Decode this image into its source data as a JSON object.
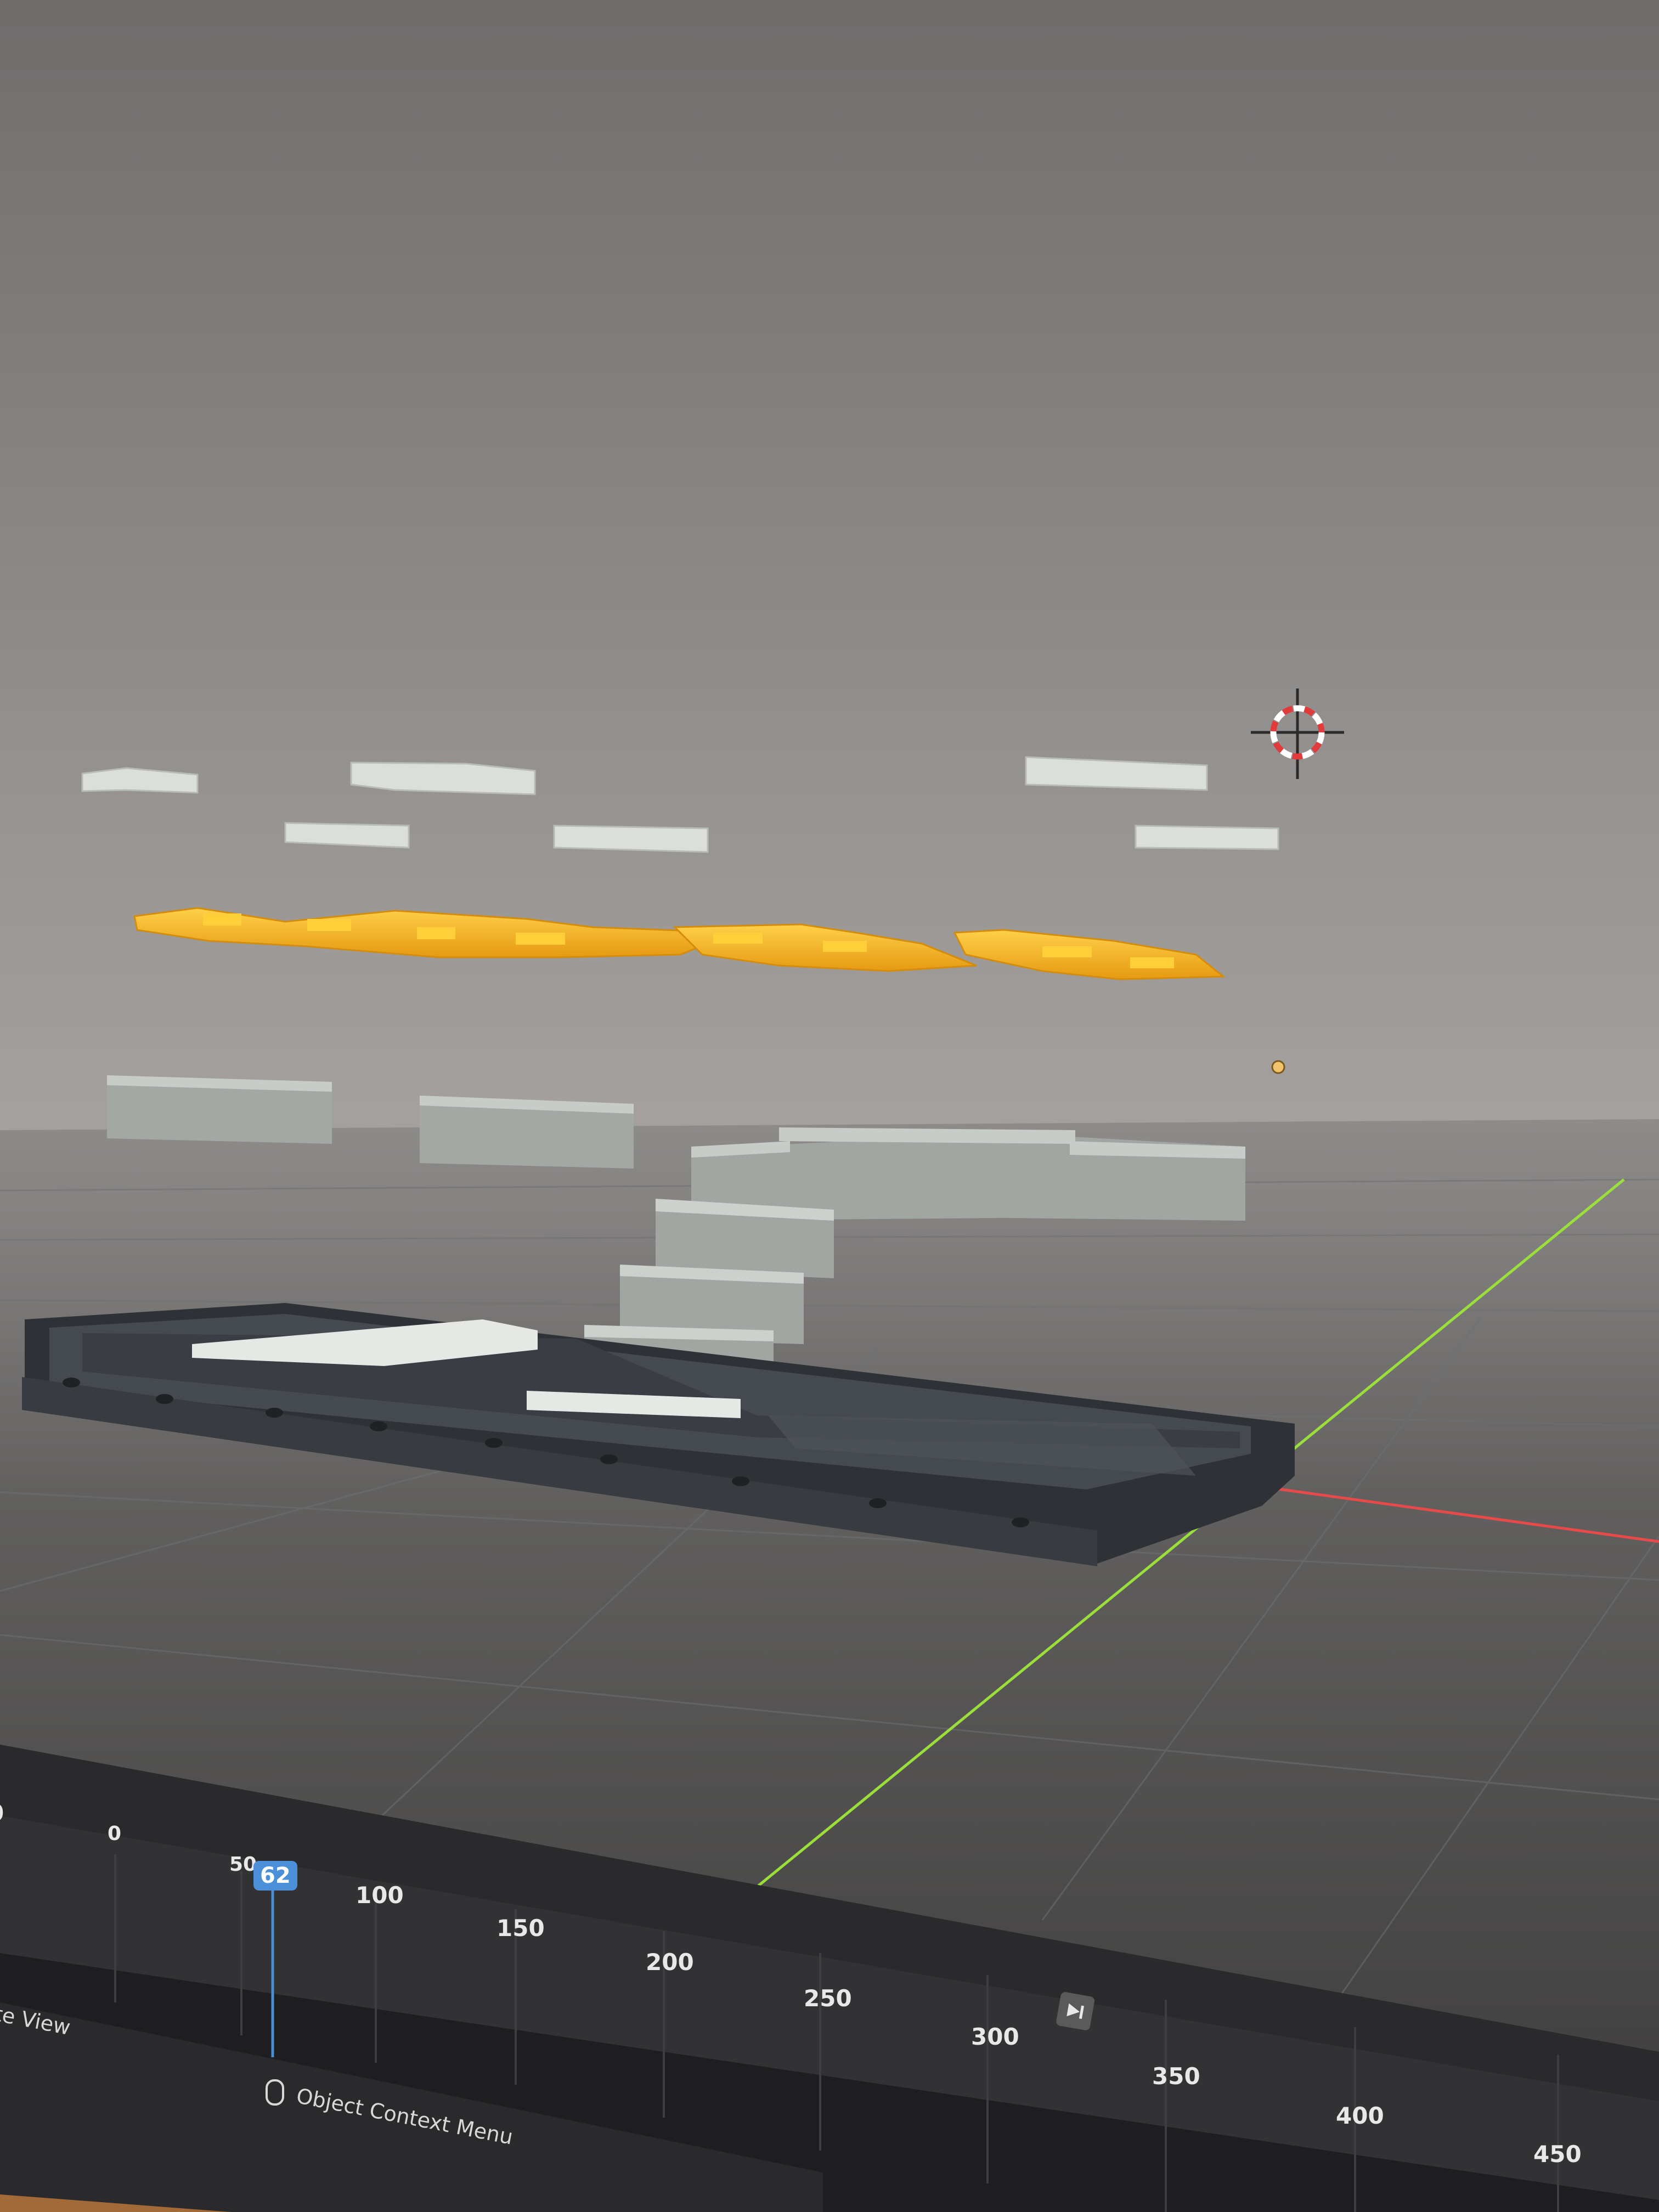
{
  "viewport": {
    "background_top": "#7f7d7c",
    "background_mid": "#a29f9d",
    "floor_color": "#4b4a49",
    "grid_color": "#6c6b6a",
    "x_axis_color": "#e84a4a",
    "y_axis_color": "#9be03a",
    "selected_color": "#f6ac1c",
    "object_color": "#c4c9c5",
    "frame_color": "#3a3d42",
    "cursor_icon": "3d-cursor-icon"
  },
  "timeline": {
    "left_labels": [
      "0",
      "0"
    ],
    "ticks": [
      "50",
      "100",
      "150",
      "200",
      "250",
      "300",
      "350",
      "400",
      "450"
    ],
    "current_frame": "62",
    "view_label": "te View",
    "status_hint": "Object Context Menu",
    "status_icon": "mouse-icon",
    "record_icon": "record-icon",
    "playback_icons": [
      "jump-start-icon",
      "prev-keyframe-icon",
      "play-reverse-icon",
      "play-icon",
      "next-keyframe-icon",
      "jump-end-icon"
    ]
  }
}
